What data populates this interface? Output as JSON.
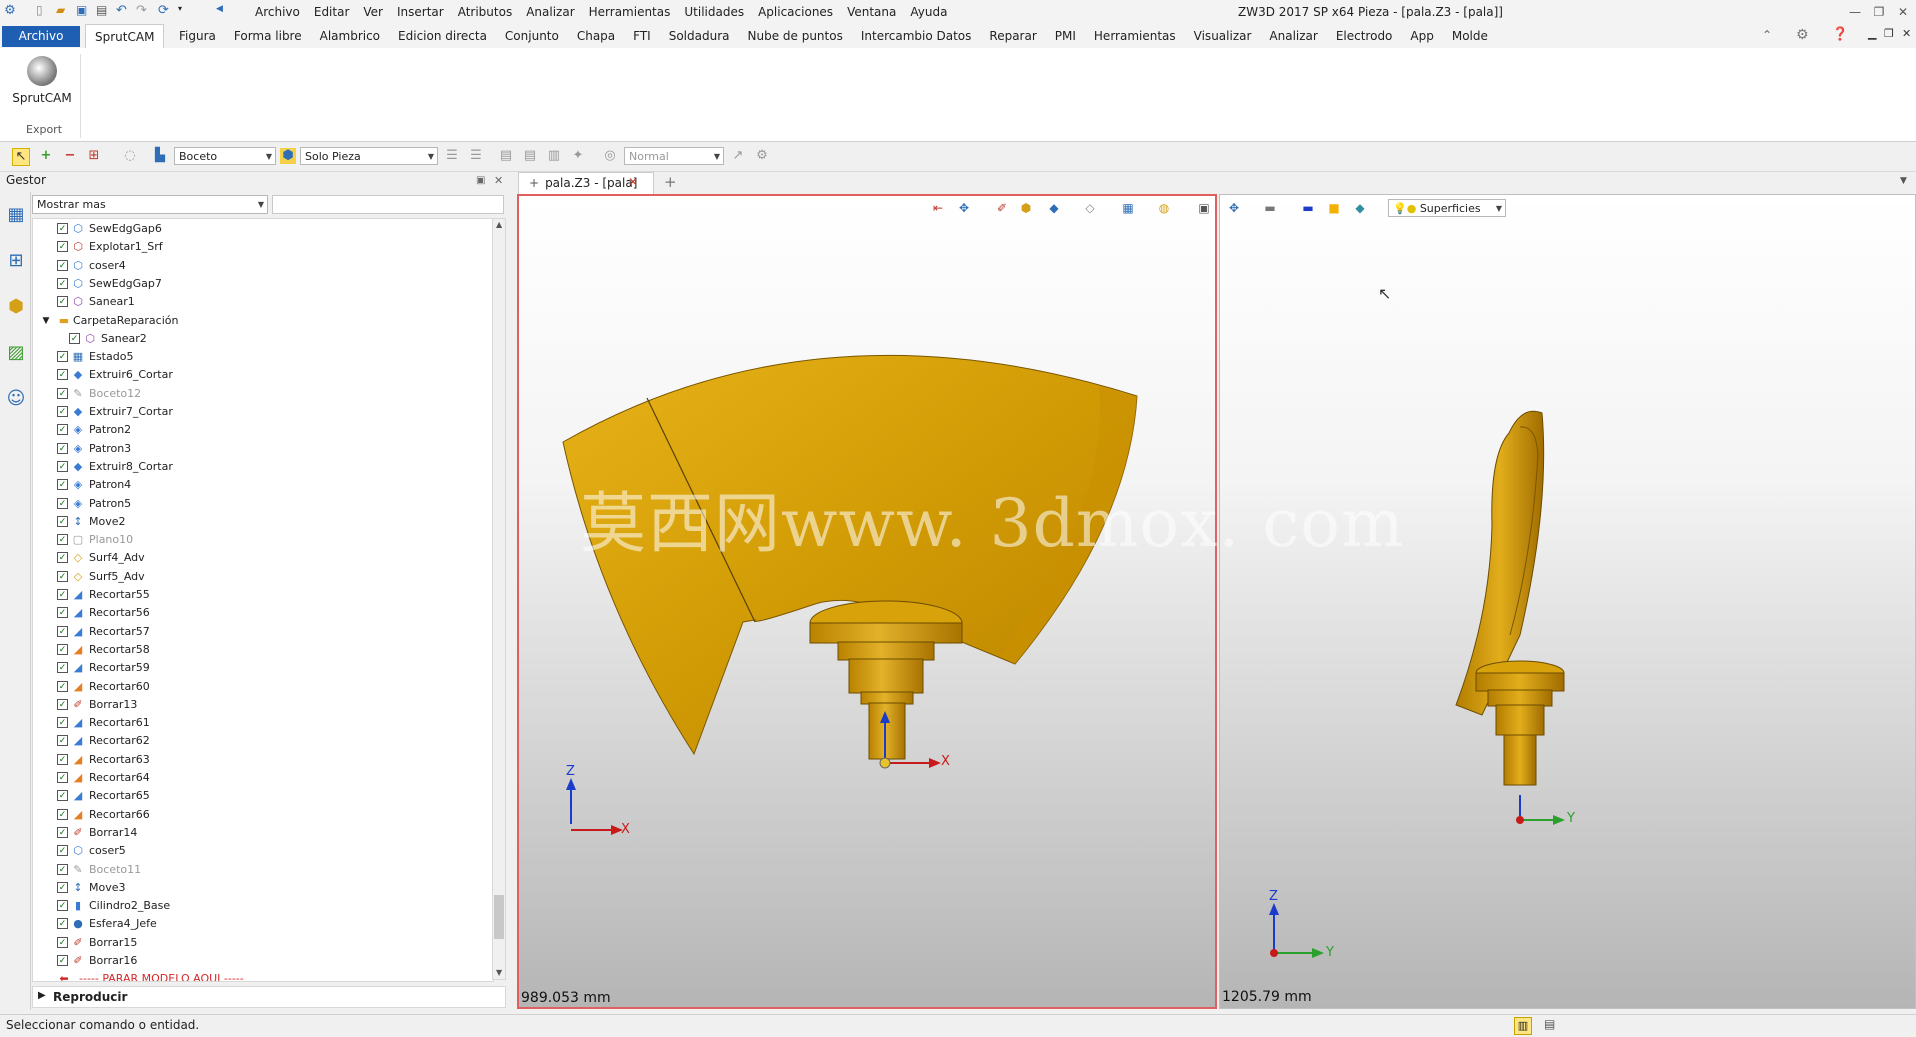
{
  "menu": [
    "Archivo",
    "Editar",
    "Ver",
    "Insertar",
    "Atributos",
    "Analizar",
    "Herramientas",
    "Utilidades",
    "Aplicaciones",
    "Ventana",
    "Ayuda"
  ],
  "app_title": "ZW3D 2017 SP x64",
  "doc_title": "Pieza - [pala.Z3 - [pala]]",
  "ribbon_tabs": [
    "Figura",
    "Forma libre",
    "Alambrico",
    "Edicion directa",
    "Conjunto",
    "Chapa",
    "FTI",
    "Soldadura",
    "Nube de puntos",
    "Intercambio Datos",
    "Reparar",
    "PMI",
    "Herramientas",
    "Visualizar",
    "Analizar",
    "Electrodo",
    "App",
    "Molde"
  ],
  "ribbon_file_tab": "Archivo",
  "ribbon_active_tab": "SprutCAM",
  "ribbon_button": "SprutCAM",
  "ribbon_group": "Export",
  "toolbar": {
    "sketch_combo": "Boceto",
    "filter_combo": "Solo Pieza",
    "view_combo": "Normal"
  },
  "panel": {
    "title": "Gestor",
    "filter_value": "Mostrar mas",
    "play_label": "Reproducir"
  },
  "tree": [
    {
      "label": "SewEdgGap6",
      "icon": "⬡",
      "color": "#3a7bd5",
      "muted": false
    },
    {
      "label": "Explotar1_Srf",
      "icon": "⬡",
      "color": "#c0392b",
      "muted": false
    },
    {
      "label": "coser4",
      "icon": "⬡",
      "color": "#3a7bd5",
      "muted": false
    },
    {
      "label": "SewEdgGap7",
      "icon": "⬡",
      "color": "#3a7bd5",
      "muted": false
    },
    {
      "label": "Sanear1",
      "icon": "⬡",
      "color": "#8e44ad",
      "muted": false
    },
    {
      "label": "CarpetaReparación",
      "icon": "▬",
      "color": "#e0a020",
      "muted": false,
      "folder": true
    },
    {
      "label": "Sanear2",
      "icon": "⬡",
      "color": "#8e44ad",
      "muted": false,
      "indent": true
    },
    {
      "label": "Estado5",
      "icon": "▦",
      "color": "#2f6db6",
      "muted": false
    },
    {
      "label": "Extruir6_Cortar",
      "icon": "◆",
      "color": "#3a7bd5",
      "muted": false
    },
    {
      "label": "Boceto12",
      "icon": "✎",
      "color": "#999",
      "muted": true
    },
    {
      "label": "Extruir7_Cortar",
      "icon": "◆",
      "color": "#3a7bd5",
      "muted": false
    },
    {
      "label": "Patron2",
      "icon": "◈",
      "color": "#3a7bd5",
      "muted": false
    },
    {
      "label": "Patron3",
      "icon": "◈",
      "color": "#3a7bd5",
      "muted": false
    },
    {
      "label": "Extruir8_Cortar",
      "icon": "◆",
      "color": "#3a7bd5",
      "muted": false
    },
    {
      "label": "Patron4",
      "icon": "◈",
      "color": "#3a7bd5",
      "muted": false
    },
    {
      "label": "Patron5",
      "icon": "◈",
      "color": "#3a7bd5",
      "muted": false
    },
    {
      "label": "Move2",
      "icon": "↕",
      "color": "#2f6db6",
      "muted": false
    },
    {
      "label": "Plano10",
      "icon": "▢",
      "color": "#999",
      "muted": true
    },
    {
      "label": "Surf4_Adv",
      "icon": "◇",
      "color": "#d4a017",
      "muted": false
    },
    {
      "label": "Surf5_Adv",
      "icon": "◇",
      "color": "#d4a017",
      "muted": false
    },
    {
      "label": "Recortar55",
      "icon": "◢",
      "color": "#3a7bd5",
      "muted": false
    },
    {
      "label": "Recortar56",
      "icon": "◢",
      "color": "#3a7bd5",
      "muted": false
    },
    {
      "label": "Recortar57",
      "icon": "◢",
      "color": "#3a7bd5",
      "muted": false
    },
    {
      "label": "Recortar58",
      "icon": "◢",
      "color": "#e67e22",
      "muted": false
    },
    {
      "label": "Recortar59",
      "icon": "◢",
      "color": "#3a7bd5",
      "muted": false
    },
    {
      "label": "Recortar60",
      "icon": "◢",
      "color": "#e67e22",
      "muted": false
    },
    {
      "label": "Borrar13",
      "icon": "✐",
      "color": "#c0392b",
      "muted": false
    },
    {
      "label": "Recortar61",
      "icon": "◢",
      "color": "#3a7bd5",
      "muted": false
    },
    {
      "label": "Recortar62",
      "icon": "◢",
      "color": "#3a7bd5",
      "muted": false
    },
    {
      "label": "Recortar63",
      "icon": "◢",
      "color": "#e67e22",
      "muted": false
    },
    {
      "label": "Recortar64",
      "icon": "◢",
      "color": "#e67e22",
      "muted": false
    },
    {
      "label": "Recortar65",
      "icon": "◢",
      "color": "#3a7bd5",
      "muted": false
    },
    {
      "label": "Recortar66",
      "icon": "◢",
      "color": "#e67e22",
      "muted": false
    },
    {
      "label": "Borrar14",
      "icon": "✐",
      "color": "#c0392b",
      "muted": false
    },
    {
      "label": "coser5",
      "icon": "⬡",
      "color": "#3a7bd5",
      "muted": false
    },
    {
      "label": "Boceto11",
      "icon": "✎",
      "color": "#999",
      "muted": true
    },
    {
      "label": "Move3",
      "icon": "↕",
      "color": "#2f6db6",
      "muted": false
    },
    {
      "label": "Cilindro2_Base",
      "icon": "▮",
      "color": "#3a7bd5",
      "muted": false
    },
    {
      "label": "Esfera4_Jefe",
      "icon": "●",
      "color": "#2f6db6",
      "muted": false
    },
    {
      "label": "Borrar15",
      "icon": "✐",
      "color": "#c0392b",
      "muted": false
    },
    {
      "label": "Borrar16",
      "icon": "✐",
      "color": "#c0392b",
      "muted": false
    }
  ],
  "stop_marker": "----- PARAR MODELO AQUI -----",
  "doc_tab": "pala.Z3 - [pala]",
  "viewport1": {
    "scale": "989.053 mm",
    "axis_x": "X",
    "axis_z": "Z",
    "triad_x": "X"
  },
  "viewport2": {
    "scale": "1205.79 mm",
    "axis_y": "Y",
    "axis_z": "Z",
    "triad_y": "Y",
    "display_mode": "Superficies"
  },
  "watermark": "莫西网www. 3dmox. com",
  "status": "Seleccionar comando o entidad.",
  "colors": {
    "accent": "#1f5fb3",
    "part": "#d9a006",
    "active_border": "#e06060"
  }
}
